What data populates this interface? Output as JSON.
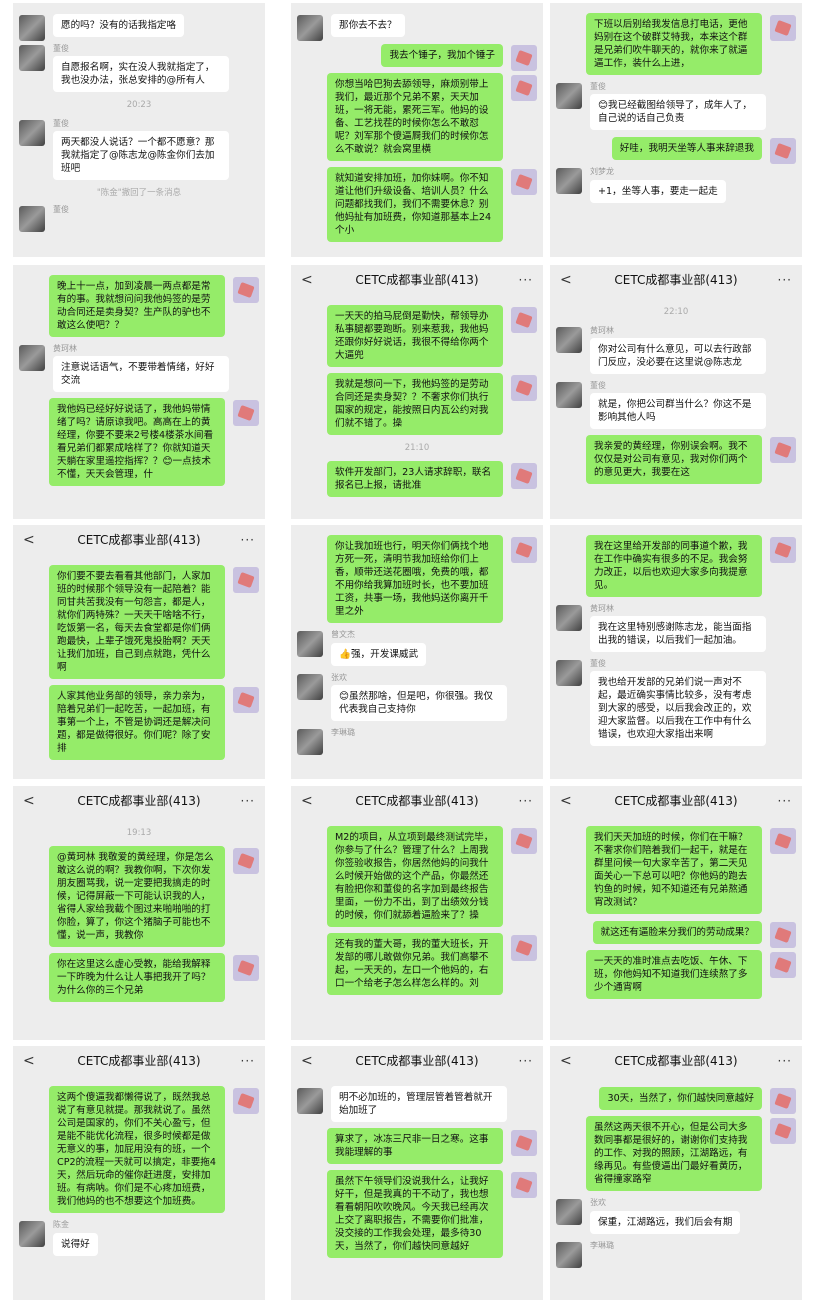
{
  "panels": [
    {
      "title": "",
      "messages": [
        {
          "type": "msg",
          "side": "left",
          "name": "",
          "text": "愿的吗？没有的话我指定咯"
        },
        {
          "type": "msg",
          "side": "left",
          "name": "董俊",
          "text": "自愿报名啊，实在没人我就指定了，我也没办法，张总安排的@所有人"
        },
        {
          "type": "time",
          "text": "20:23"
        },
        {
          "type": "msg",
          "side": "left",
          "name": "董俊",
          "text": "两天都没人说话？一个都不愿意？那我就指定了@陈志龙@陈金你们去加班吧"
        },
        {
          "type": "sys",
          "text": "\"陈金\"撤回了一条消息"
        },
        {
          "type": "msg",
          "side": "left",
          "name": "董俊",
          "text": ""
        }
      ]
    },
    {
      "title": "",
      "messages": [
        {
          "type": "msg",
          "side": "left",
          "name": "",
          "text": "那你去不去？"
        },
        {
          "type": "msg",
          "side": "right",
          "name": "",
          "text": "我去个锤子，我加个锤子"
        },
        {
          "type": "msg",
          "side": "right",
          "name": "",
          "text": "你想当哈巴狗去舔领导，麻烦别带上我们，最近那个兄弟不累，天天加班，一将无能，累死三军。他妈的设备、工艺找茬的时候你怎么不敢怼呢？刘军那个傻逼屙我们的时候你怎么不敢说？就会窝里横"
        },
        {
          "type": "msg",
          "side": "right",
          "name": "",
          "text": "就知道安排加班，加你妹啊。你不知道让他们升级设备、培训人员？什么问题都找我们，我们不需要休息？别他妈扯有加班费，你知道那基本上24个小"
        }
      ]
    },
    {
      "title": "",
      "messages": [
        {
          "type": "msg",
          "side": "right",
          "name": "",
          "text": "下班以后别给我发信息打电话，更他妈别在这个破群艾特我，本来这个群是兄弟们吹牛聊天的，就你来了就逼逼工作，装什么上进，"
        },
        {
          "type": "msg",
          "side": "left",
          "name": "董俊",
          "text": "😊我已经截图给领导了，成年人了，自己说的话自己负责"
        },
        {
          "type": "msg",
          "side": "right",
          "name": "",
          "text": "好哇，我明天坐等人事来辞退我"
        },
        {
          "type": "msg",
          "side": "left",
          "name": "刘梦龙",
          "text": "+1，坐等人事，要走一起走"
        }
      ]
    },
    {
      "title": "",
      "messages": [
        {
          "type": "msg",
          "side": "right",
          "name": "",
          "text": "晚上十一点，加到凌晨一两点都是常有的事。我就想问问我他妈签的是劳动合同还是卖身契？生产队的驴也不敢这么使吧？？"
        },
        {
          "type": "msg",
          "side": "left",
          "name": "黄珂林",
          "text": "注意说话语气，不要带着情绪，好好交流"
        },
        {
          "type": "msg",
          "side": "right",
          "name": "",
          "text": "我他妈已经好好说话了，我他妈带情绪了吗？请原谅我吧。高高在上的黄经理，你要不要来2号楼4楼茶水间看看兄弟们都累成啥样了？你就知道天天躺在家里遥控指挥？？😊一点技术不懂，天天会管理，什"
        }
      ]
    },
    {
      "title": "CETC成都事业部(413)",
      "messages": [
        {
          "type": "msg",
          "side": "right",
          "name": "",
          "text": "一天天的拍马屁倒是勤快，帮领导办私事腿都要跑断。别来惹我，我他妈还跟你好好说话，我很不得给你两个大逼兜"
        },
        {
          "type": "msg",
          "side": "right",
          "name": "",
          "text": "我就是想问一下，我他妈签的是劳动合同还是卖身契？？不奢求你们执行国家的规定，能按照日内瓦公约对我们就不错了。操"
        },
        {
          "type": "time",
          "text": "21:10"
        },
        {
          "type": "msg",
          "side": "right",
          "name": "",
          "text": "软件开发部门，23人请求辞职，联名报名已上报，请批准"
        }
      ]
    },
    {
      "title": "CETC成都事业部(413)",
      "messages": [
        {
          "type": "time",
          "text": "22:10"
        },
        {
          "type": "msg",
          "side": "left",
          "name": "黄珂林",
          "text": "你对公司有什么意见，可以去行政部门反应，没必要在这里说@陈志龙"
        },
        {
          "type": "msg",
          "side": "left",
          "name": "董俊",
          "text": "就是，你把公司群当什么？你这不是影响其他人吗"
        },
        {
          "type": "msg",
          "side": "right",
          "name": "",
          "text": "我亲爱的黄经理，你别误会啊。我不仅仅是对公司有意见，我对你们两个的意见更大，我要在这"
        }
      ]
    },
    {
      "title": "CETC成都事业部(413)",
      "messages": [
        {
          "type": "msg",
          "side": "right",
          "name": "",
          "text": "你们要不要去看看其他部门，人家加班的时候那个领导没有一起陪着？能同甘共苦我没有一句怨言，都是人，就你们两特殊？一天天干啥啥不行，吃饭第一名，每天去食堂都是你们俩跑最快，上辈子饿死鬼投胎啊？天天让我们加班，自己到点就跑，凭什么啊"
        },
        {
          "type": "msg",
          "side": "right",
          "name": "",
          "text": "人家其他业务部的领导，亲力亲为，陪着兄弟们一起吃苦，一起加班，有事第一个上，不管是协调还是解决问题，都是做得很好。你们呢？除了安排"
        }
      ]
    },
    {
      "title": "",
      "messages": [
        {
          "type": "msg",
          "side": "right",
          "name": "",
          "text": "你让我加班也行，明天你们俩找个地方死一死，清明节我加班给你们上香，顺带还送花圈哦，免费的哦，都不用你给我算加班时长，也不要加班工资，共事一场，我他妈送你离开千里之外"
        },
        {
          "type": "msg",
          "side": "left",
          "name": "曾文杰",
          "text": "👍强，开发课威武"
        },
        {
          "type": "msg",
          "side": "left",
          "name": "张欢",
          "text": "😊虽然那啥，但是吧，你很强。我仅代表我自己支持你"
        },
        {
          "type": "msg",
          "side": "left",
          "name": "李琳璐",
          "text": ""
        }
      ]
    },
    {
      "title": "",
      "messages": [
        {
          "type": "msg",
          "side": "right",
          "name": "",
          "text": "我在这里给开发部的同事道个歉，我在工作中确实有很多的不足。我会努力改正，以后也欢迎大家多向我提意见。"
        },
        {
          "type": "msg",
          "side": "left",
          "name": "黄珂林",
          "text": "我在这里特别感谢陈志龙，能当面指出我的错误，以后我们一起加油。"
        },
        {
          "type": "msg",
          "side": "left",
          "name": "董俊",
          "text": "我也给开发部的兄弟们说一声对不起，最近确实事情比较多，没有考虑到大家的感受，以后我会改正的，欢迎大家监督。以后我在工作中有什么错误，也欢迎大家指出来啊"
        }
      ]
    },
    {
      "title": "CETC成都事业部(413)",
      "messages": [
        {
          "type": "time",
          "text": "19:13"
        },
        {
          "type": "msg",
          "side": "right",
          "name": "",
          "text": "@黄珂林 我敬爱的黄经理，你是怎么敢这么说的啊？我教你啊，下次你发朋友圈骂我，说一定要把我搞走的时候，记得屏蔽一下可能认识我的人，省得人家给我截个图过来啪啪啪的打你脸，算了，你这个猪脑子可能也不懂，说一声，我教你"
        },
        {
          "type": "msg",
          "side": "right",
          "name": "",
          "text": "你在这里这么虚心受教，能给我解释一下昨晚为什么让人事把我开了吗？为什么你的三个兄弟"
        }
      ]
    },
    {
      "title": "CETC成都事业部(413)",
      "messages": [
        {
          "type": "msg",
          "side": "right",
          "name": "",
          "text": "M2的项目，从立项到最终测试完毕，你参与了什么？管理了什么？上周我你签验收报告，你居然他妈的问我什么时候开始做的这个产品，你最然还有脸把你和董俊的名字加到最终报告里面，一份力不出，到了出绩效分钱的时候，你们就舔着逼脸来了？操"
        },
        {
          "type": "msg",
          "side": "right",
          "name": "",
          "text": "还有我的董大哥，我的董大班长，开发部的哪儿敢做你兄弟。我们高攀不起，一天天的，左口一个他妈的，右口一个给老子怎么样怎么样的。刘"
        }
      ]
    },
    {
      "title": "CETC成都事业部(413)",
      "messages": [
        {
          "type": "msg",
          "side": "right",
          "name": "",
          "text": "我们天天加班的时候，你们在干嘛？不奢求你们陪着我们一起干，就是在群里问候一句大家辛苦了，第二天见面关心一下总可以吧？你他妈的跑去钓鱼的时候，知不知道还有兄弟熬通宵改测试？"
        },
        {
          "type": "msg",
          "side": "right",
          "name": "",
          "text": "就这还有逼脸来分我们的劳动成果？"
        },
        {
          "type": "msg",
          "side": "right",
          "name": "",
          "text": "一天天的准时准点去吃饭、午休、下班，你他妈知不知道我们连续熬了多少个通宵啊"
        }
      ]
    },
    {
      "title": "CETC成都事业部(413)",
      "messages": [
        {
          "type": "msg",
          "side": "right",
          "name": "",
          "text": "这两个傻逼我都懒得说了，既然我总说了有意见就提。那我就说了。虽然公司是国家的，你们不关心盈亏，但是能不能优化流程，很多时候都是做无意义的事，加屁用没有的班，一个CP2的流程一天就可以搞定，非要拖4天，然后玩命的催你赶进度，安排加班。有病呐。你们是不心疼加班费，我们他妈的也不想要这个加班费。"
        },
        {
          "type": "msg",
          "side": "left",
          "name": "陈金",
          "text": "说得好"
        }
      ]
    },
    {
      "title": "CETC成都事业部(413)",
      "messages": [
        {
          "type": "msg",
          "side": "left",
          "name": "",
          "text": "明不必加班的，管理层管着管着就开始加班了"
        },
        {
          "type": "msg",
          "side": "right",
          "name": "",
          "text": "算求了，冰冻三尺非一日之寒。这事我能理解的事"
        },
        {
          "type": "msg",
          "side": "right",
          "name": "",
          "text": "虽然下午领导们没说我什么，让我好好干，但是我真的干不动了，我也想看看朝阳吹吹晚风。今天我已经再次上交了离职报告，不需要你们批准，没交接的工作我会处理，最多待30天，当然了，你们越快同意越好"
        }
      ]
    },
    {
      "title": "CETC成都事业部(413)",
      "messages": [
        {
          "type": "msg",
          "side": "right",
          "name": "",
          "text": "30天，当然了，你们越快同意越好"
        },
        {
          "type": "msg",
          "side": "right",
          "name": "",
          "text": "虽然这两天很不开心，但是公司大多数同事都是很好的，谢谢你们支持我的工作、对我的照顾，江湖路远，有缘再见。有些傻逼出门最好看黄历，省得撞家路窄"
        },
        {
          "type": "msg",
          "side": "left",
          "name": "张欢",
          "text": "保重，江湖路远，我们后会有期"
        },
        {
          "type": "msg",
          "side": "left",
          "name": "李琳璐",
          "text": ""
        }
      ]
    }
  ],
  "ui": {
    "back_glyph": "<",
    "more_glyph": "···"
  }
}
